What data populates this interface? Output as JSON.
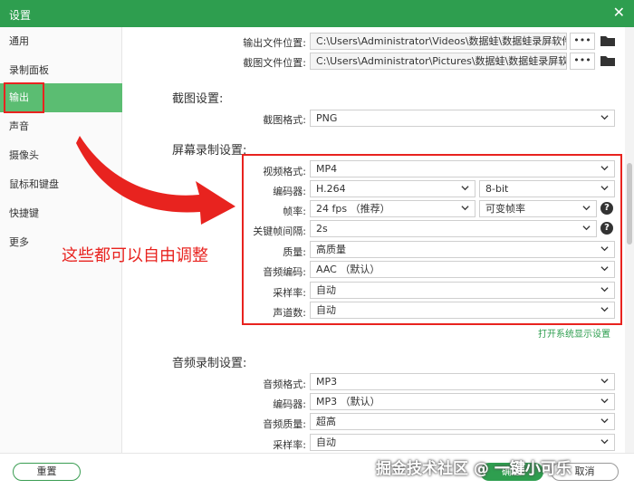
{
  "window": {
    "title": "设置",
    "close": "✕"
  },
  "sidebar": {
    "items": [
      {
        "label": "通用"
      },
      {
        "label": "录制面板"
      },
      {
        "label": "输出"
      },
      {
        "label": "声音"
      },
      {
        "label": "摄像头"
      },
      {
        "label": "鼠标和键盘"
      },
      {
        "label": "快捷键"
      },
      {
        "label": "更多"
      }
    ]
  },
  "output": {
    "video_path_label": "输出文件位置:",
    "video_path": "C:\\Users\\Administrator\\Videos\\数据蛙\\数据蛙录屏软件",
    "shot_path_label": "截图文件位置:",
    "shot_path": "C:\\Users\\Administrator\\Pictures\\数据蛙\\数据蛙录屏软件",
    "more": "•••"
  },
  "screenshot": {
    "title": "截图设置:",
    "format_label": "截图格式:",
    "format": "PNG"
  },
  "screen_rec": {
    "title": "屏幕录制设置:",
    "video_format_label": "视频格式:",
    "video_format": "MP4",
    "encoder_label": "编码器:",
    "encoder": "H.264",
    "bitdepth": "8-bit",
    "fps_label": "帧率:",
    "fps": "24 fps （推荐）",
    "fps_mode": "可变帧率",
    "keyframe_label": "关键帧间隔:",
    "keyframe": "2s",
    "quality_label": "质量:",
    "quality": "高质量",
    "audio_codec_label": "音频编码:",
    "audio_codec": "AAC （默认）",
    "samplerate_label": "采样率:",
    "samplerate": "自动",
    "channels_label": "声道数:",
    "channels": "自动",
    "open_display_link": "打开系统显示设置"
  },
  "audio_rec": {
    "title": "音频录制设置:",
    "format_label": "音频格式:",
    "format": "MP3",
    "encoder_label": "编码器:",
    "encoder": "MP3 （默认）",
    "quality_label": "音频质量:",
    "quality": "超高",
    "samplerate_label": "采样率:",
    "samplerate": "自动"
  },
  "annotation": {
    "text": "这些都可以自由调整"
  },
  "footer": {
    "reset": "重置",
    "ok": "确定",
    "cancel": "取消"
  },
  "watermark": "掘金技术社区 @ 一键小可乐",
  "colors": {
    "accent": "#2e9e4f",
    "highlight": "#e8231f"
  }
}
